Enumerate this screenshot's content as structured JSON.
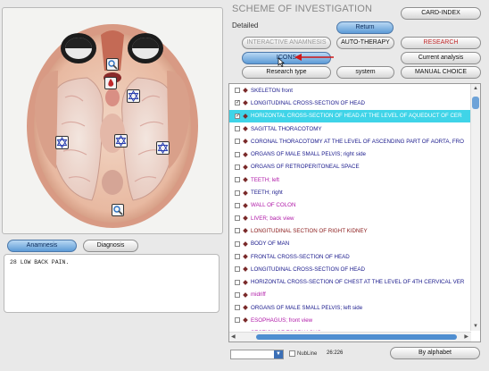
{
  "header": {
    "title": "SCHEME OF INVESTIGATION",
    "subtitle": "Detailed"
  },
  "buttons": {
    "card_index": "CARD-INDEX",
    "return": "Return",
    "interactive_anamnesis": "INTERACTIVE ANAMNESIS",
    "auto_therapy": "AUTO-THERAPY",
    "research": "RESEARCH",
    "icons": "ICONS",
    "current_analysis": "Current analysis",
    "research_type": "Research type",
    "system": "system",
    "manual_choice": "MANUAL CHOICE",
    "by_alphabet": "By alphabet"
  },
  "left_tabs": {
    "anamnesis": "Anamnesis",
    "diagnosis": "Diagnosis"
  },
  "notes": {
    "text": "28 LOW BACK PAIN."
  },
  "list_items": [
    {
      "label": "SKELETON front",
      "color": "#1a1a8c",
      "checked": false,
      "selected": false
    },
    {
      "label": "LONGITUDINAL CROSS-SECTION OF HEAD",
      "color": "#1a1a8c",
      "checked": true,
      "selected": false
    },
    {
      "label": "HORIZONTAL CROSS-SECTION OF HEAD AT THE LEVEL OF AQUEDUCT OF CER",
      "color": "#ffffff",
      "checked": true,
      "selected": true
    },
    {
      "label": "SAGITTAL THORACOTOMY",
      "color": "#1a1a8c",
      "checked": false,
      "selected": false
    },
    {
      "label": "CORONAL THORACOTOMY AT THE LEVEL OF ASCENDING PART OF AORTA, FRO",
      "color": "#1a1a8c",
      "checked": false,
      "selected": false
    },
    {
      "label": "ORGANS OF MALE SMALL PELVIS; right side",
      "color": "#1a1a8c",
      "checked": false,
      "selected": false
    },
    {
      "label": "ORGANS OF RETROPERITONEAL SPACE",
      "color": "#1a1a8c",
      "checked": false,
      "selected": false
    },
    {
      "label": "TEETH; left",
      "color": "#b01aa8",
      "checked": false,
      "selected": false
    },
    {
      "label": "TEETH; right",
      "color": "#1a1a8c",
      "checked": false,
      "selected": false
    },
    {
      "label": "WALL OF COLON",
      "color": "#b01aa8",
      "checked": false,
      "selected": false
    },
    {
      "label": "LIVER; back view",
      "color": "#b01aa8",
      "checked": false,
      "selected": false
    },
    {
      "label": "LONGITUDINAL  SECTION  OF  RIGHT  KIDNEY",
      "color": "#8a1a1a",
      "checked": false,
      "selected": false
    },
    {
      "label": "BODY OF MAN",
      "color": "#1a1a8c",
      "checked": false,
      "selected": false
    },
    {
      "label": "FRONTAL CROSS-SECTION OF HEAD",
      "color": "#1a1a8c",
      "checked": false,
      "selected": false
    },
    {
      "label": "LONGITUDINAL CROSS-SECTION OF HEAD",
      "color": "#1a1a8c",
      "checked": false,
      "selected": false
    },
    {
      "label": "HORIZONTAL CROSS-SECTION OF CHEST AT THE LEVEL OF 4TH CERVICAL VER",
      "color": "#1a1a8c",
      "checked": false,
      "selected": false
    },
    {
      "label": "midriff",
      "color": "#b01aa8",
      "checked": false,
      "selected": false
    },
    {
      "label": "ORGANS OF MALE SMALL PELVIS; left side",
      "color": "#1a1a8c",
      "checked": false,
      "selected": false
    },
    {
      "label": "ESOPHAGUS; front view",
      "color": "#b01aa8",
      "checked": false,
      "selected": false
    },
    {
      "label": "SECTION OF ESOPHAGUS",
      "color": "#b01aa8",
      "checked": false,
      "selected": false
    },
    {
      "label": "TRANSITION OF ESOPHAGUS TO STOMACH",
      "color": "#b01aa8",
      "checked": false,
      "selected": false
    }
  ],
  "footer": {
    "nubline_label": "NubLine",
    "coordinates": "26:226"
  },
  "colors": {
    "selection": "#3fd4e8",
    "accent_blue": "#5d9bd6",
    "research_red": "#c0282a"
  },
  "icons": [
    "search-icon",
    "star-of-david-icon",
    "blood-drop-icon",
    "pointer-icon"
  ]
}
